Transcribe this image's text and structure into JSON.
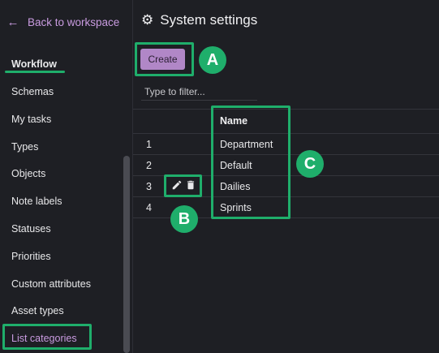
{
  "sidebar": {
    "back_label": "Back to workspace",
    "items": [
      {
        "label": "Workflow"
      },
      {
        "label": "Schemas"
      },
      {
        "label": "My tasks"
      },
      {
        "label": "Types"
      },
      {
        "label": "Objects"
      },
      {
        "label": "Note labels"
      },
      {
        "label": "Statuses"
      },
      {
        "label": "Priorities"
      },
      {
        "label": "Custom attributes"
      },
      {
        "label": "Asset types"
      },
      {
        "label": "List categories"
      }
    ],
    "active_item": "Workflow",
    "selected_item": "List categories"
  },
  "header": {
    "title": "System settings",
    "icon": "gear-icon"
  },
  "toolbar": {
    "create_label": "Create"
  },
  "filter": {
    "placeholder": "Type to filter..."
  },
  "table": {
    "column_header": "Name",
    "rows": [
      {
        "number": "1",
        "name": "Department"
      },
      {
        "number": "2",
        "name": "Default"
      },
      {
        "number": "3",
        "name": "Dailies"
      },
      {
        "number": "4",
        "name": "Sprints"
      }
    ]
  },
  "callouts": {
    "a": "A",
    "b": "B",
    "c": "C"
  },
  "colors": {
    "background": "#1e1f24",
    "accent": "#c99be0",
    "create_button": "#b187c7",
    "highlight": "#1fae6b"
  }
}
